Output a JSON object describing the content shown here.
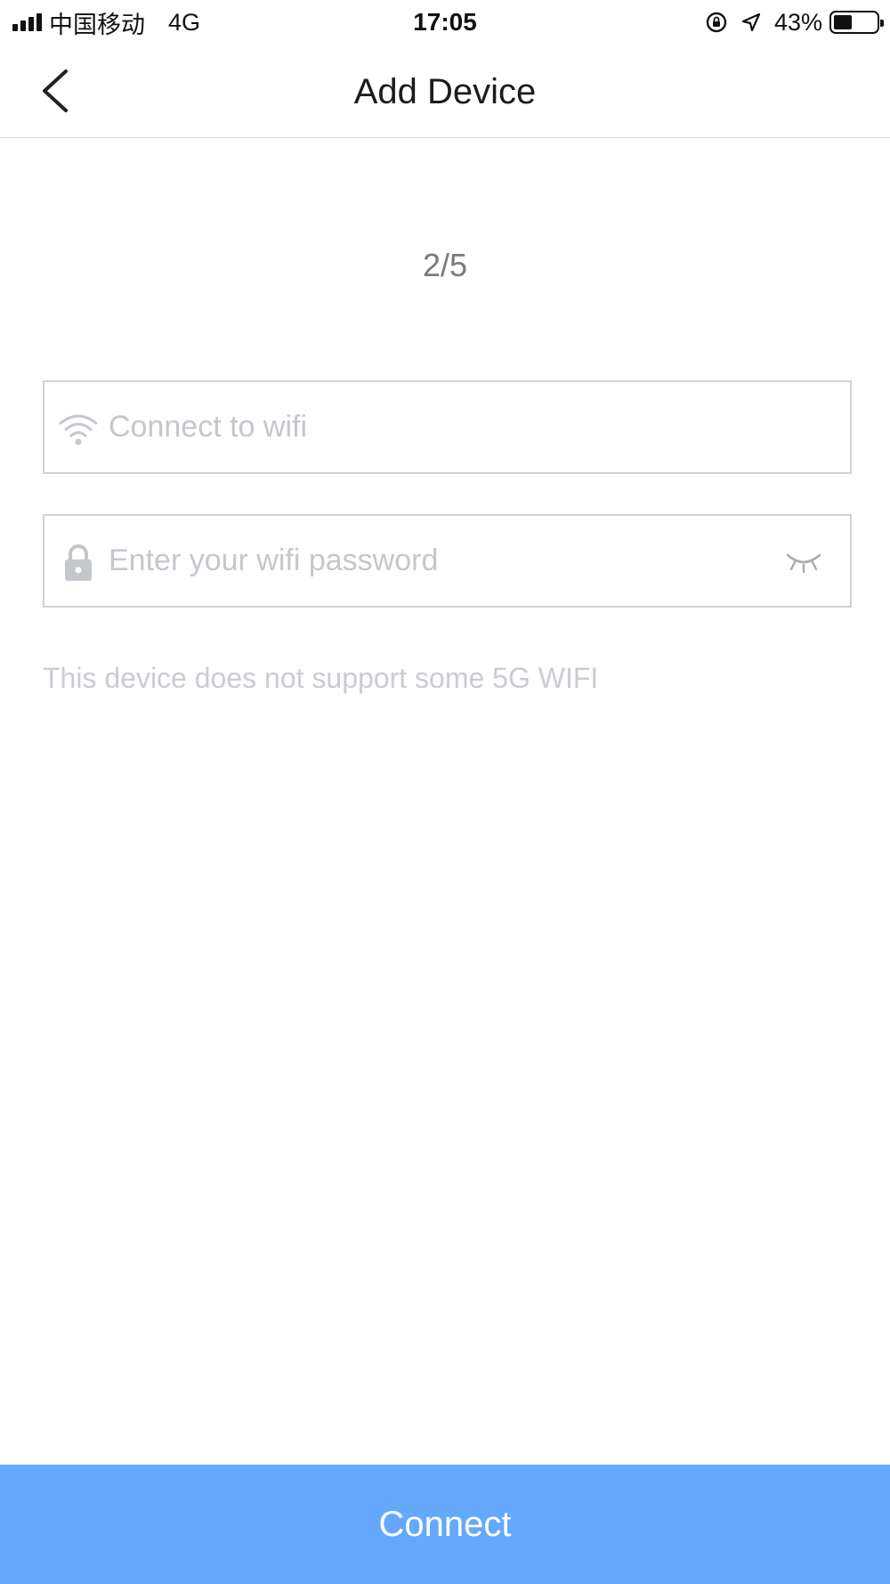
{
  "status_bar": {
    "carrier": "中国移动",
    "network": "4G",
    "time": "17:05",
    "battery_percent": "43%",
    "battery_level": 0.43
  },
  "nav": {
    "title": "Add Device",
    "back_icon": "chevron-left-icon"
  },
  "step": {
    "label": "2/5"
  },
  "wifi_field": {
    "icon": "wifi-icon",
    "placeholder": "Connect to wifi",
    "value": ""
  },
  "password_field": {
    "icon": "lock-icon",
    "placeholder": "Enter your wifi password",
    "value": "",
    "toggle_icon": "eye-closed-icon"
  },
  "hint": {
    "text": "This device does not support some 5G WIFI"
  },
  "connect_button": {
    "label": "Connect",
    "color": "#64a9fb"
  },
  "colors": {
    "accent": "#64a9fb",
    "placeholder": "#c4c7cc",
    "border": "#d2d2d2"
  }
}
